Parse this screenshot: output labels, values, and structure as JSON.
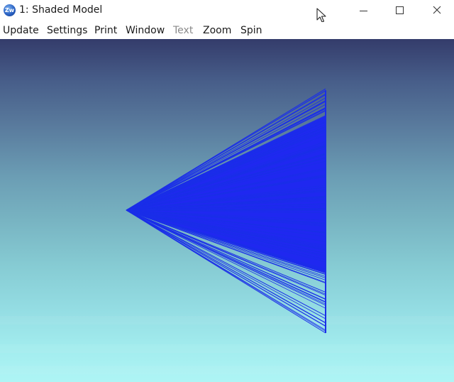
{
  "window": {
    "title": "1: Shaded Model",
    "icon": "zw-app-icon",
    "icon_text": "Zw"
  },
  "controls": {
    "minimize_icon": "minimize-icon",
    "maximize_icon": "maximize-icon",
    "close_icon": "close-icon"
  },
  "menu": {
    "items": [
      {
        "label": "Update",
        "enabled": true
      },
      {
        "label": "Settings",
        "enabled": true
      },
      {
        "label": "Print",
        "enabled": true
      },
      {
        "label": "Window",
        "enabled": true
      },
      {
        "label": "Text",
        "enabled": false
      },
      {
        "label": "Zoom",
        "enabled": true
      },
      {
        "label": "Spin",
        "enabled": true
      }
    ]
  },
  "viewport": {
    "background_top": "#343c6b",
    "background_bottom": "#aef5f5",
    "line_color": "#1a2ee8",
    "fill_color": "#1f28f0"
  }
}
